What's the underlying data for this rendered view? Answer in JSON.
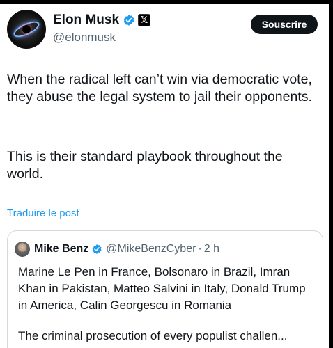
{
  "author": {
    "name": "Elon Musk",
    "handle": "@elonmusk",
    "subscribe_label": "Souscrire",
    "badge_icon": "verified-icon",
    "affiliate_icon": "x-logo-icon",
    "x_glyph": "𝕏"
  },
  "post": {
    "paragraph1": "When the radical left can’t win via democratic vote, they abuse the legal system to jail their opponents.",
    "paragraph2": "This is their standard playbook throughout the world.",
    "translate_label": "Traduire le post"
  },
  "quote": {
    "name": "Mike Benz",
    "handle": "@MikeBenzCyber",
    "separator": "·",
    "time": "2 h",
    "paragraph1": "Marine Le Pen in France, Bolsonaro in Brazil, Imran Khan in Pakistan, Matteo Salvini in Italy, Donald Trump in America, Calin Georgescu in Romania",
    "paragraph2": "The criminal prosecution of every populist challen..."
  },
  "colors": {
    "verified_blue": "#1d9bf0",
    "text_primary": "#0f1419",
    "text_secondary": "#536471"
  }
}
